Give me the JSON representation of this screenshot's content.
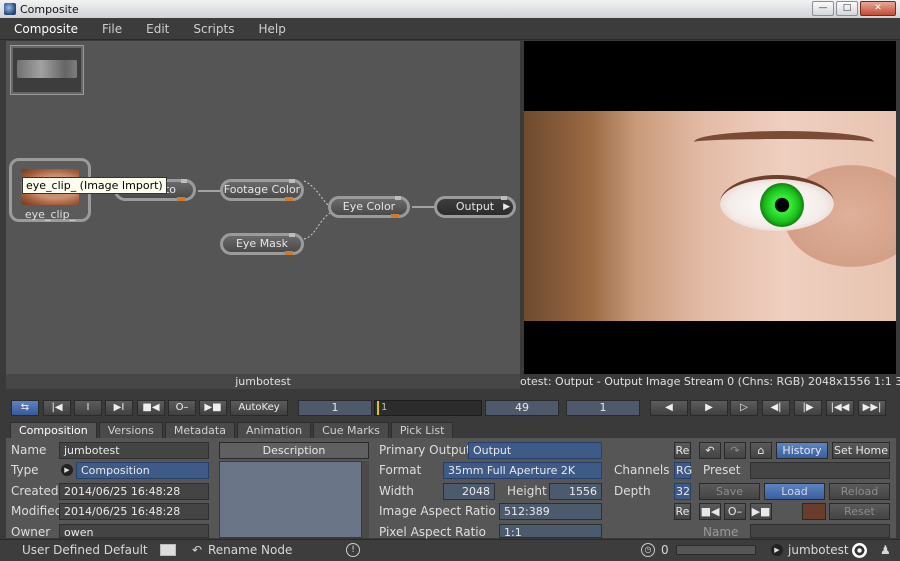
{
  "window": {
    "title": "Composite"
  },
  "menu": [
    "Composite",
    "File",
    "Edit",
    "Scripts",
    "Help"
  ],
  "graph": {
    "footer": "jumbotest",
    "clip_node": "eye_clip_",
    "tooltip": "eye_clip_ (Image Import)",
    "nodes": {
      "histo": "Histo",
      "footage_color": "Footage Color",
      "eye_color": "Eye Color",
      "output": "Output",
      "eye_mask": "Eye Mask"
    }
  },
  "viewer": {
    "status": "otest: Output - Output Image  Stream 0 (Chns: RGB)  2048x1556  1:1  32 Bits  Zoo"
  },
  "transport": {
    "autokey": "AutoKey",
    "start": "1",
    "timeline_label": "1",
    "end": "49",
    "current": "1"
  },
  "tabs": [
    "Composition",
    "Versions",
    "Metadata",
    "Animation",
    "Cue Marks",
    "Pick List"
  ],
  "props": {
    "name_label": "Name",
    "name": "jumbotest",
    "type_label": "Type",
    "type": "Composition",
    "created_label": "Created",
    "created": "2014/06/25 16:48:28",
    "modified_label": "Modified",
    "modified": "2014/06/25 16:48:28",
    "owner_label": "Owner",
    "owner": "owen",
    "description_label": "Description",
    "primary_output_label": "Primary Output",
    "primary_output": "Output",
    "format_label": "Format",
    "format": "35mm Full Aperture 2K",
    "width_label": "Width",
    "width": "2048",
    "height_label": "Height",
    "height": "1556",
    "image_aspect_label": "Image Aspect Ratio",
    "image_aspect": "512:389",
    "pixel_aspect_label": "Pixel Aspect Ratio",
    "pixel_aspect": "1:1",
    "channels_label": "Channels",
    "channels": "RG",
    "depth_label": "Depth",
    "depth": "32",
    "re": "Re",
    "history": "History",
    "set_home": "Set Home",
    "preset_label": "Preset",
    "save": "Save",
    "load": "Load",
    "reload": "Reload",
    "reset": "Reset",
    "name2_label": "Name"
  },
  "status": {
    "preset": "User Defined Default",
    "rename": "Rename Node",
    "value": "0",
    "comp": "jumbotest"
  },
  "colors": {
    "accent_blue": "#3e5a86",
    "port_orange": "#d07a2a",
    "iris_green": "#1bbd1b"
  }
}
